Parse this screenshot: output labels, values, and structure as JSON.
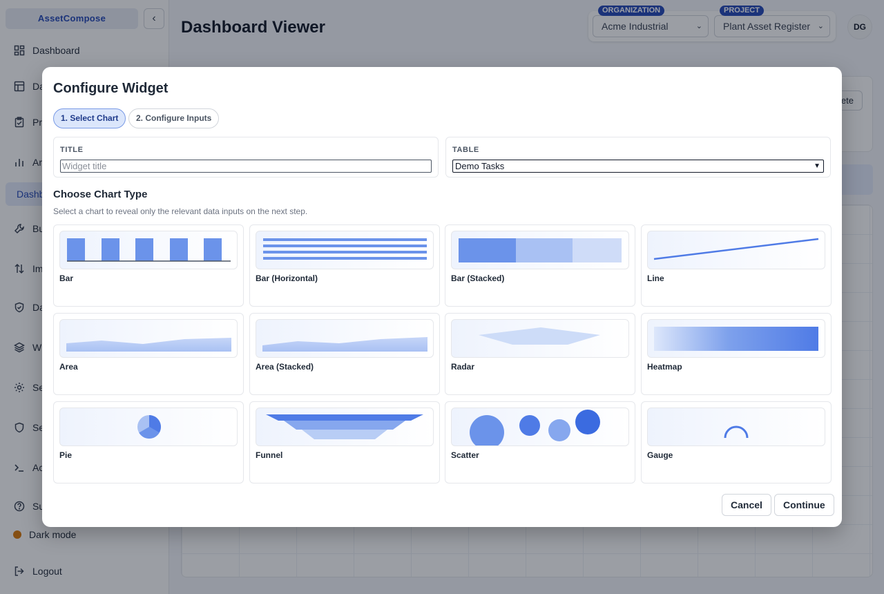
{
  "sidebar": {
    "brand": "AssetCompose",
    "collapse_icon": "chevron-left-icon",
    "items": [
      {
        "label": "Dashboard",
        "icon": "layout-grid-icon"
      },
      {
        "label": "Da",
        "icon": "table-icon"
      },
      {
        "label": "Pr",
        "icon": "clipboard-check-icon"
      },
      {
        "label": "Ar",
        "icon": "bar-chart-icon"
      },
      {
        "label": "Dashb",
        "icon": ""
      },
      {
        "label": "Bu",
        "icon": "wrench-icon"
      },
      {
        "label": "Im",
        "icon": "arrows-up-down-icon"
      },
      {
        "label": "Da",
        "icon": "shield-check-icon"
      },
      {
        "label": "W",
        "icon": "layers-icon"
      },
      {
        "label": "Se",
        "icon": "gear-icon"
      },
      {
        "label": "Se",
        "icon": "shield-icon"
      },
      {
        "label": "Ac",
        "icon": "terminal-icon"
      },
      {
        "label": "Su",
        "icon": "help-circle-icon"
      }
    ],
    "dark_mode_label": "Dark mode",
    "logout_label": "Logout"
  },
  "header": {
    "title": "Dashboard Viewer",
    "organization": {
      "badge": "ORGANIZATION",
      "value": "Acme Industrial"
    },
    "project": {
      "badge": "PROJECT",
      "value": "Plant Asset Register"
    },
    "avatar_initials": "DG"
  },
  "background": {
    "delete_label": "ete"
  },
  "modal": {
    "title": "Configure Widget",
    "steps": [
      {
        "label": "1. Select Chart",
        "active": true
      },
      {
        "label": "2. Configure Inputs",
        "active": false
      }
    ],
    "title_field": {
      "label": "TITLE",
      "placeholder": "Widget title",
      "value": ""
    },
    "table_field": {
      "label": "TABLE",
      "value": "Demo Tasks"
    },
    "section_title": "Choose Chart Type",
    "section_subtitle": "Select a chart to reveal only the relevant data inputs on the next step.",
    "chart_types": [
      "Bar",
      "Bar (Horizontal)",
      "Bar (Stacked)",
      "Line",
      "Area",
      "Area (Stacked)",
      "Radar",
      "Heatmap",
      "Pie",
      "Funnel",
      "Scatter",
      "Gauge"
    ],
    "cancel_label": "Cancel",
    "continue_label": "Continue"
  },
  "colors": {
    "accent": "#2447b7",
    "chart_blue": "#4f7be6",
    "chart_light": "#a9c1f3"
  }
}
